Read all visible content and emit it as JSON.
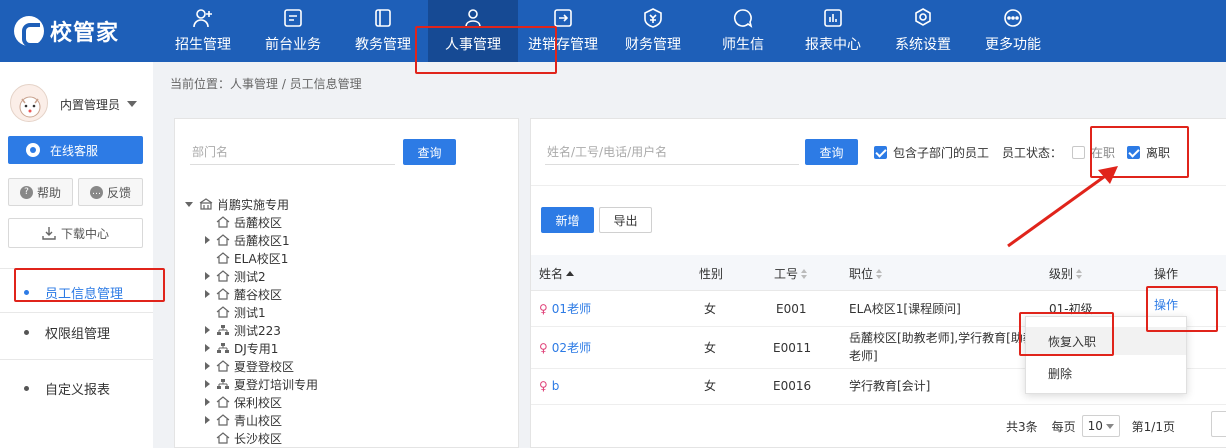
{
  "app": {
    "logo_text": "校管家"
  },
  "nav": [
    {
      "label": "招生管理",
      "icon": "person-add-icon"
    },
    {
      "label": "前台业务",
      "icon": "monitor-icon"
    },
    {
      "label": "教务管理",
      "icon": "book-icon"
    },
    {
      "label": "人事管理",
      "icon": "person-icon",
      "active": true
    },
    {
      "label": "进销存管理",
      "icon": "box-arrow-icon"
    },
    {
      "label": "财务管理",
      "icon": "yen-shield-icon"
    },
    {
      "label": "师生信",
      "icon": "chat-icon"
    },
    {
      "label": "报表中心",
      "icon": "chart-icon"
    },
    {
      "label": "系统设置",
      "icon": "gear-icon"
    },
    {
      "label": "更多功能",
      "icon": "more-icon"
    }
  ],
  "sidebar": {
    "user_name": "内置管理员",
    "online_service": "在线客服",
    "help": "帮助",
    "feedback": "反馈",
    "download_center": "下载中心",
    "menu": [
      {
        "label": "员工信息管理",
        "active": true
      },
      {
        "label": "权限组管理"
      },
      {
        "label": "自定义报表"
      }
    ]
  },
  "breadcrumb": "当前位置：人事管理 / 员工信息管理",
  "dept_panel": {
    "placeholder": "部门名",
    "query_label": "查询",
    "tree": [
      {
        "label": "肖鹏实施专用",
        "level": 0,
        "expanded": true,
        "icon": "building-icon"
      },
      {
        "label": "岳麓校区",
        "level": 1,
        "icon": "home-icon"
      },
      {
        "label": "岳麓校区1",
        "level": 1,
        "arrow": true,
        "icon": "home-icon"
      },
      {
        "label": "ELA校区1",
        "level": 1,
        "icon": "home-icon"
      },
      {
        "label": "测试2",
        "level": 1,
        "arrow": true,
        "icon": "home-icon"
      },
      {
        "label": "麓谷校区",
        "level": 1,
        "arrow": true,
        "icon": "home-icon"
      },
      {
        "label": "测试1",
        "level": 1,
        "icon": "home-icon"
      },
      {
        "label": "测试223",
        "level": 1,
        "arrow": true,
        "icon": "org-icon"
      },
      {
        "label": "DJ专用1",
        "level": 1,
        "arrow": true,
        "icon": "org-icon"
      },
      {
        "label": "夏登登校区",
        "level": 1,
        "arrow": true,
        "icon": "home-icon"
      },
      {
        "label": "夏登灯培训专用",
        "level": 1,
        "arrow": true,
        "icon": "org-icon"
      },
      {
        "label": "保利校区",
        "level": 1,
        "arrow": true,
        "icon": "home-icon"
      },
      {
        "label": "青山校区",
        "level": 1,
        "arrow": true,
        "icon": "home-icon"
      },
      {
        "label": "长沙校区",
        "level": 1,
        "icon": "home-icon"
      }
    ]
  },
  "main": {
    "search_placeholder": "姓名/工号/电话/用户名",
    "query_label": "查询",
    "include_sub_label": "包含子部门的员工",
    "include_sub_checked": true,
    "status_label": "员工状态：",
    "status_active_label": "在职",
    "status_active_checked": false,
    "status_left_label": "离职",
    "status_left_checked": true,
    "add_label": "新增",
    "export_label": "导出",
    "columns": [
      "姓名",
      "性别",
      "工号",
      "职位",
      "级别",
      "操作"
    ],
    "rows": [
      {
        "name": "01老师",
        "gender": "女",
        "id": "E001",
        "position_l1": "ELA校区1[课程顾问]",
        "position_l2": "",
        "level": "01-初级",
        "action": "操作"
      },
      {
        "name": "02老师",
        "gender": "女",
        "id": "E0011",
        "position_l1": "岳麓校区[助教老师],学行教育[助教",
        "position_l2": "老师]",
        "level": "",
        "action": ""
      },
      {
        "name": "b",
        "gender": "女",
        "id": "E0016",
        "position_l1": "学行教育[会计]",
        "position_l2": "",
        "level": "",
        "action": ""
      }
    ],
    "pager": {
      "total": "共3条",
      "per_page_label": "每页",
      "per_page_value": "10",
      "page_info": "第1/1页"
    }
  },
  "dropdown": {
    "items": [
      "恢复入职",
      "删除"
    ]
  },
  "colors": {
    "topbar": "#1e5fb8",
    "primary": "#2d7be5",
    "annotation": "#e0241b"
  }
}
